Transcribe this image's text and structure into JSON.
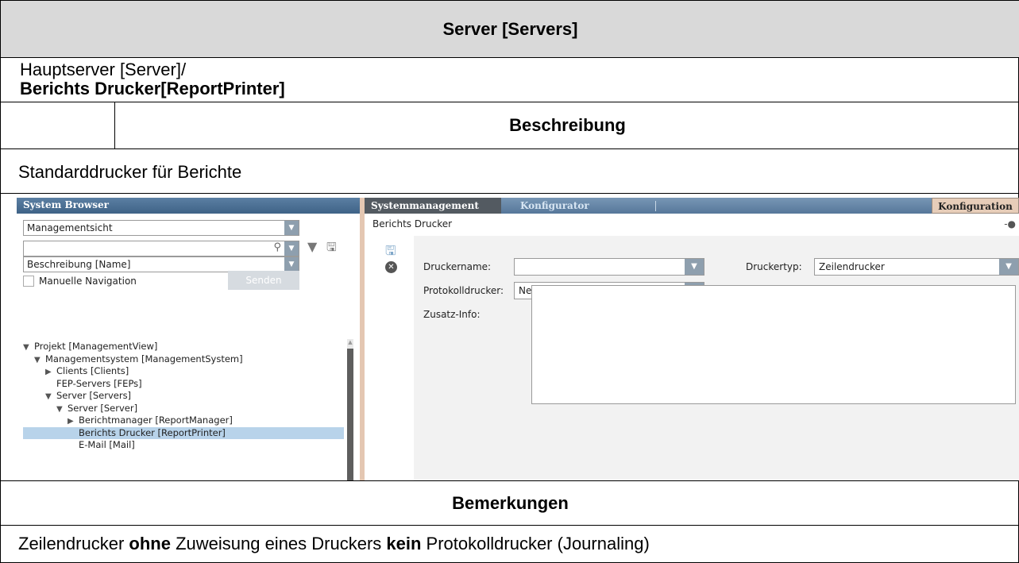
{
  "doc": {
    "title": "Server [Servers]",
    "path_line1": "Hauptserver [Server]/",
    "path_line2": "Berichts Drucker[ReportPrinter]",
    "col_header": "Beschreibung",
    "description": "Standarddrucker für Berichte",
    "remarks_header": "Bemerkungen",
    "note": {
      "p1": "Zeilendrucker ",
      "b1": "ohne",
      "p2": " Zuweisung eines Druckers ",
      "b2": "kein",
      "p3": " Protokolldrucker (Journaling)"
    }
  },
  "browser": {
    "header": "System Browser",
    "view_select": "Managementsicht",
    "search_value": "",
    "name_select": "Beschreibung [Name]",
    "manual_nav_label": "Manuelle Navigation",
    "send_button": "Senden",
    "tree": [
      {
        "label": "Projekt [ManagementView]",
        "expander": "expanded"
      },
      {
        "label": "Managementsystem [ManagementSystem]",
        "expander": "expanded"
      },
      {
        "label": "Clients [Clients]",
        "expander": "collapsed"
      },
      {
        "label": "FEP-Servers [FEPs]",
        "expander": "none"
      },
      {
        "label": "Server [Servers]",
        "expander": "expanded"
      },
      {
        "label": "Server [Server]",
        "expander": "expanded"
      },
      {
        "label": "Berichtmanager [ReportManager]",
        "expander": "collapsed"
      },
      {
        "label": "Berichts Drucker [ReportPrinter]",
        "expander": "none",
        "selected": true
      },
      {
        "label": "E-Mail [Mail]",
        "expander": "none"
      }
    ]
  },
  "panel": {
    "tab_active": "Systemmanagement",
    "tab_inactive": "Konfigurator",
    "tab_right": "Konfiguration",
    "breadcrumb": "Berichts Drucker",
    "printer_name_label": "Druckername:",
    "printer_name_value": "",
    "printer_type_label": "Druckertyp:",
    "printer_type_value": "Zeilendrucker",
    "log_printer_label": "Protokolldrucker:",
    "log_printer_value": "Nein",
    "extra_info_label": "Zusatz-Info:",
    "extra_info_value": ""
  }
}
